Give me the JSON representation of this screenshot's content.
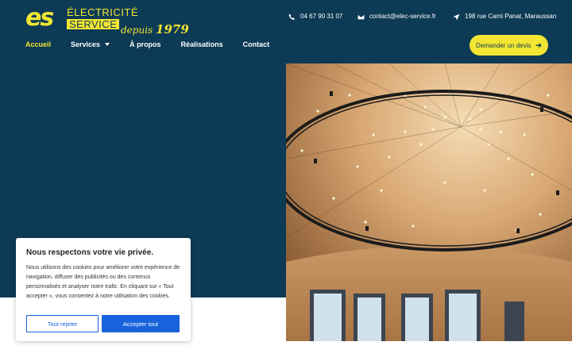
{
  "brand": {
    "logo_mark": "es",
    "line1": "ÉLECTRICITÉ",
    "line2": "SERVICE",
    "since_prefix": "depuis",
    "since_year": "1979",
    "color_yellow": "#f2e632",
    "color_navy": "#0d3a55"
  },
  "contact": {
    "phone": "04 67 90 31 07",
    "phone_icon": "phone-icon",
    "email": "contact@elec-service.fr",
    "email_icon": "envelope-icon",
    "address": "198 rue Cami Panat, Maraussan",
    "address_icon": "location-arrow-icon"
  },
  "nav": {
    "items": [
      {
        "label": "Accueil",
        "active": true
      },
      {
        "label": "Services",
        "has_dropdown": true
      },
      {
        "label": "À propos"
      },
      {
        "label": "Réalisations"
      },
      {
        "label": "Contact"
      }
    ],
    "cta_label": "Demander un devis",
    "cta_icon": "arrow-right-icon"
  },
  "hero": {
    "image_alt": "Wooden dome ceiling with circular string-light truss"
  },
  "cookie": {
    "title": "Nous respectons votre vie privée.",
    "text": "Nous utilisons des cookies pour améliorer votre expérience de navigation, diffuser des publicités ou des contenus personnalisés et analyser notre trafic. En cliquant sur « Tout accepter », vous consentez à notre utilisation des cookies.",
    "reject_label": "Tout rejeter",
    "accept_label": "Accepter tout",
    "accent_color": "#1863dc"
  }
}
